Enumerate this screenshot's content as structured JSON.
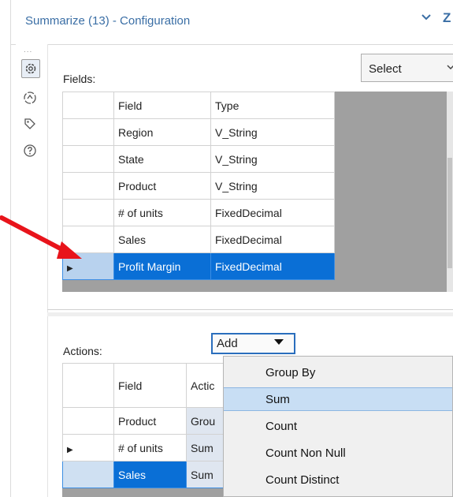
{
  "header": {
    "title": "Summarize (13) - Configuration",
    "extra_glyph": "Z"
  },
  "rail": {
    "dots": "..."
  },
  "fields": {
    "label": "Fields:",
    "select_label": "Select",
    "columns": [
      "Field",
      "Type"
    ],
    "rows": [
      {
        "field": "Region",
        "type": "V_String"
      },
      {
        "field": "State",
        "type": "V_String"
      },
      {
        "field": "Product",
        "type": "V_String"
      },
      {
        "field": "# of units",
        "type": "FixedDecimal"
      },
      {
        "field": "Sales",
        "type": "FixedDecimal"
      },
      {
        "field": "Profit Margin",
        "type": "FixedDecimal"
      }
    ],
    "selected_row": 5
  },
  "actions": {
    "label": "Actions:",
    "add_label": "Add",
    "columns": [
      "Field",
      "Actic"
    ],
    "rows": [
      {
        "field": "Product",
        "action": "Grou"
      },
      {
        "field": "# of units",
        "action": "Sum"
      },
      {
        "field": "Sales",
        "action": "Sum"
      }
    ]
  },
  "menu": {
    "items": [
      "Group By",
      "Sum",
      "Count",
      "Count Non Null",
      "Count Distinct"
    ],
    "highlighted": "Sum"
  },
  "colors": {
    "accent": "#0a6fd6",
    "title_blue": "#3a6ea5",
    "annotation_red": "#e8141b"
  }
}
